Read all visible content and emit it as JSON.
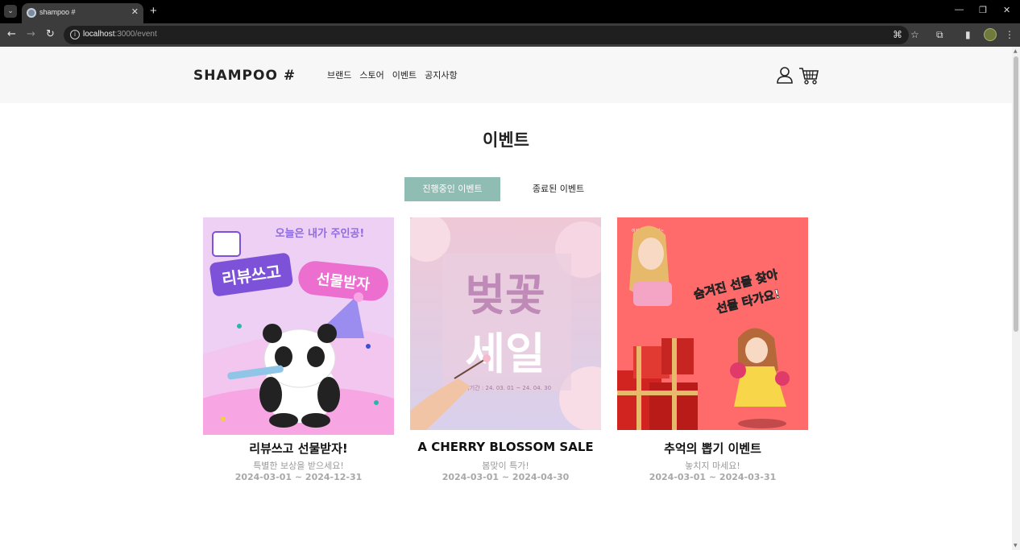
{
  "browser": {
    "tab_title": "shampoo #",
    "tab_close": "✕",
    "new_tab": "+",
    "url_host": "localhost",
    "url_path": ":3000/event",
    "window_controls": {
      "minimize": "—",
      "restore": "❐",
      "close": "✕"
    }
  },
  "header": {
    "logo": "SHAMPOO #",
    "nav": [
      "브랜드",
      "스토어",
      "이벤트",
      "공지사항"
    ]
  },
  "page": {
    "title": "이벤트",
    "tabs": [
      {
        "label": "진행중인 이벤트",
        "active": true
      },
      {
        "label": "종료된 이벤트",
        "active": false
      }
    ]
  },
  "events": [
    {
      "title": "리뷰쓰고 선물받자!",
      "subtitle": "특별한 보상을 받으세요!",
      "period": "2024-03-01 ~ 2024-12-31",
      "image": {
        "caption_top": "오늘은 내가 주인공!",
        "badge_left": "리뷰쓰고",
        "badge_right": "선물받자",
        "colors": {
          "bg": "#f3c6f0",
          "badge_left": "#7e52d8",
          "badge_right": "#ec6fd0"
        }
      }
    },
    {
      "title": "A CHERRY BLOSSOM SALE",
      "subtitle": "봄맞이 특가!",
      "period": "2024-03-01 ~ 2024-04-30",
      "image": {
        "line1": "벚꽃",
        "line2": "세일",
        "small": "행사기간 : 24. 03. 01 ~ 24. 04. 30",
        "colors": {
          "bg": "#f2d3dc",
          "line1": "#c08ab8",
          "line2": "#ffffff"
        }
      }
    },
    {
      "title": "추억의 뽑기 이벤트",
      "subtitle": "놓치지 마세요!",
      "period": "2024-03-01 ~ 2024-03-31",
      "image": {
        "speech": "이건! 득템각이야~",
        "line1": "숨겨진 선물 찾아",
        "line2": "선물 타가요!",
        "colors": {
          "bg": "#ff6a6a",
          "box": "#d1231f",
          "ribbon": "#e7b96a"
        }
      }
    }
  ]
}
